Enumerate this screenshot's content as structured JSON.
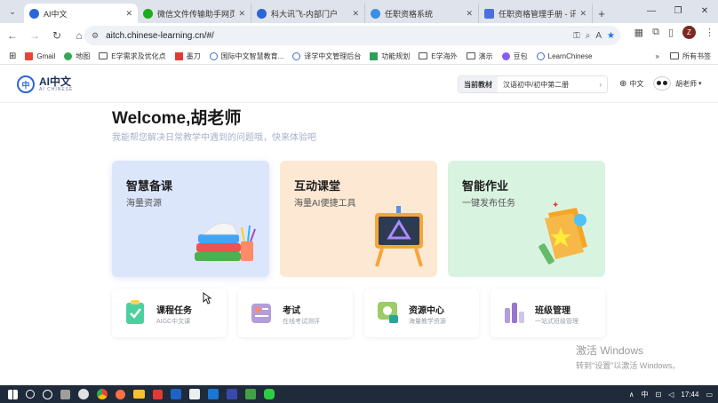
{
  "browser": {
    "tabs": [
      {
        "label": "AI中文",
        "color": "#2b66d9",
        "active": true
      },
      {
        "label": "微信文件传输助手网页版",
        "color": "#1aad19",
        "active": false
      },
      {
        "label": "科大讯飞-内部门户",
        "color": "#2b66d9",
        "active": false
      },
      {
        "label": "任职资格系统",
        "color": "#3a8ee6",
        "active": false
      },
      {
        "label": "任职资格管理手册 - 讯飞",
        "color": "#4a6fe0",
        "active": false
      }
    ],
    "new_tab": "+",
    "url": "aitch.chinese-learning.cn/#/",
    "profile_initial": "Z",
    "bookmarks": [
      {
        "label": "Gmail",
        "icon": "gmail-icon"
      },
      {
        "label": "地图",
        "icon": "maps-icon"
      },
      {
        "label": "E学需求及优化点",
        "icon": "folder-icon"
      },
      {
        "label": "墨刀",
        "icon": "modao-icon"
      },
      {
        "label": "国际中文智慧教育...",
        "icon": "globe-icon"
      },
      {
        "label": "译学中文管理后台",
        "icon": "globe-icon"
      },
      {
        "label": "功能规划",
        "icon": "doc-icon"
      },
      {
        "label": "E学海外",
        "icon": "folder-icon"
      },
      {
        "label": "演示",
        "icon": "folder-icon"
      },
      {
        "label": "豆包",
        "icon": "doubao-icon"
      },
      {
        "label": "LearnChinese",
        "icon": "globe-icon"
      }
    ],
    "bookmarks_more": "»",
    "all_bookmarks": "所有书签"
  },
  "header": {
    "logo_title": "AI中文",
    "logo_sub": "AI CHINESE",
    "textbook_label": "当前教材",
    "textbook_value": "汉语初中/初中第二册",
    "lang": "中文",
    "user_name": "胡老师"
  },
  "main": {
    "welcome": "Welcome,胡老师",
    "subtitle": "我能帮您解决日常教学中遇到的问题哦，快来体验吧",
    "big_cards": [
      {
        "title": "智慧备课",
        "sub": "海量资源",
        "bg": "#dbe6fb"
      },
      {
        "title": "互动课堂",
        "sub": "海量AI便捷工具",
        "bg": "#fde8d4"
      },
      {
        "title": "智能作业",
        "sub": "一键发布任务",
        "bg": "#d9f3e1"
      }
    ],
    "small_cards": [
      {
        "title": "课程任务",
        "sub": "AIGC中文课"
      },
      {
        "title": "考试",
        "sub": "在线考试测评"
      },
      {
        "title": "资源中心",
        "sub": "海量教学资源"
      },
      {
        "title": "班级管理",
        "sub": "一站式班级管理"
      }
    ]
  },
  "windows": {
    "activate_title": "激活 Windows",
    "activate_sub": "转到\"设置\"以激活 Windows。",
    "clock": "17:44",
    "ime": "中"
  }
}
